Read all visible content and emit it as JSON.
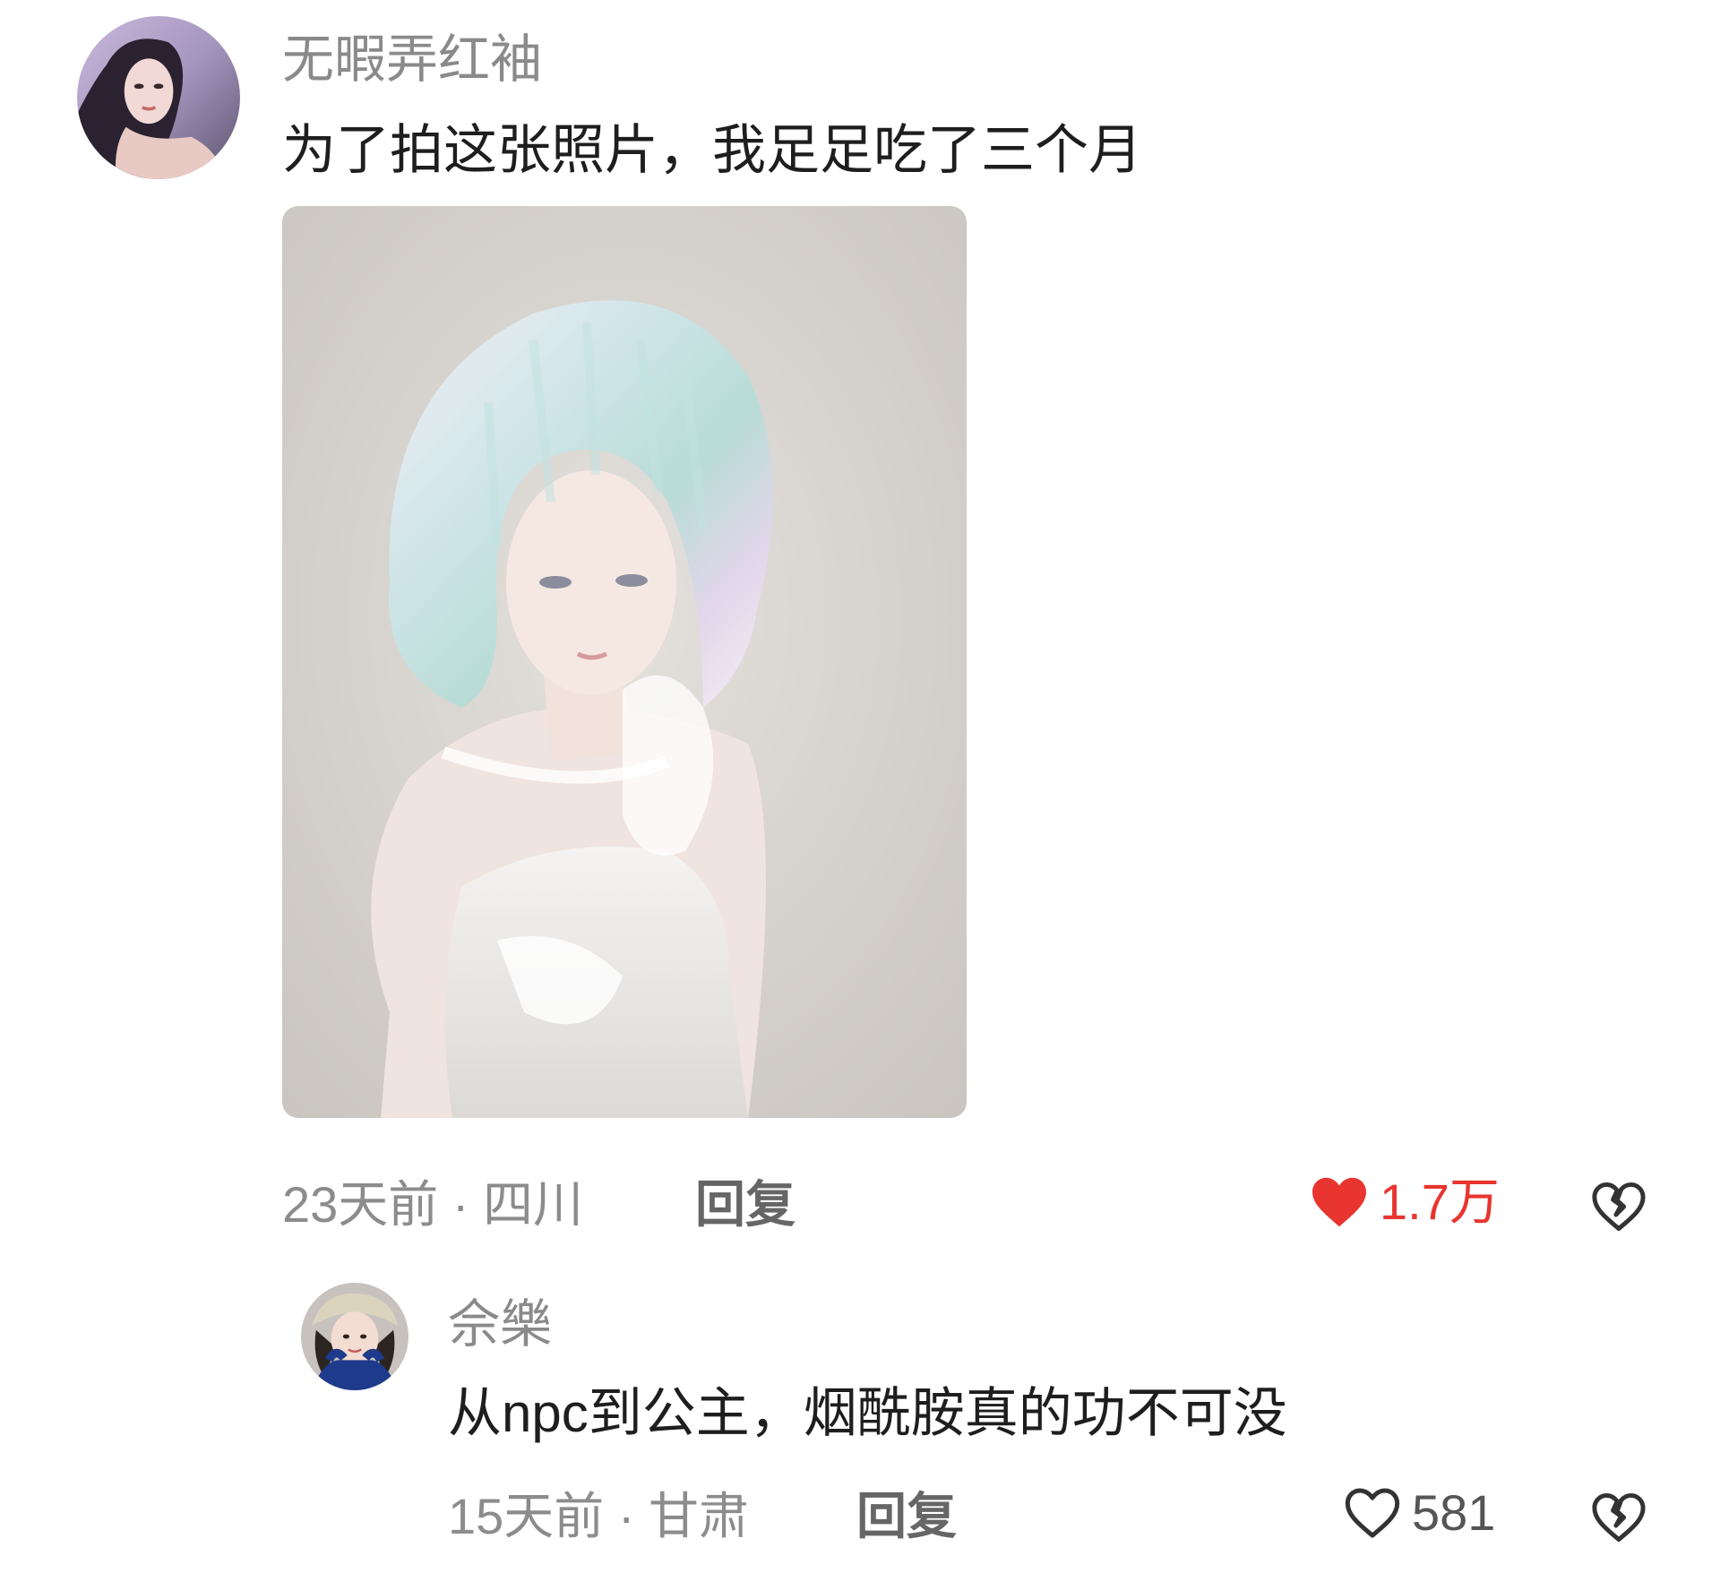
{
  "comment": {
    "username": "无暇弄红袖",
    "text": "为了拍这张照片，我足足吃了三个月",
    "meta": "23天前 · 四川",
    "reply_label": "回复",
    "like_count": "1.7万",
    "liked": true,
    "like_icon": "heart-filled-icon",
    "dislike_icon": "broken-heart-icon",
    "like_color": "#e8352f"
  },
  "reply": {
    "username": "佘樂",
    "text": "从npc到公主，烟酰胺真的功不可没",
    "meta": "15天前 · 甘肃",
    "reply_label": "回复",
    "like_count": "581",
    "liked": false,
    "like_icon": "heart-outline-icon",
    "dislike_icon": "broken-heart-icon"
  }
}
